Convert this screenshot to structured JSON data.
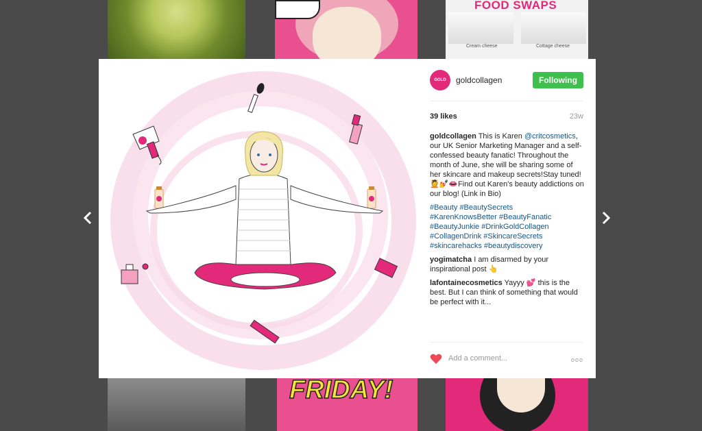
{
  "background": {
    "top_right_title": "FOOD SWAPS",
    "top_right_labels": [
      "Cream cheese",
      "Cottage cheese"
    ],
    "bottom_center_text": "FRIDAY!"
  },
  "modal": {
    "post": {
      "avatar_text": "GOLD COLLAGEN",
      "username": "goldcollagen",
      "follow_label": "Following",
      "likes": "39 likes",
      "age": "23w",
      "caption": {
        "author": "goldcollagen",
        "text_before": "This is Karen",
        "mention": "@critcosmetics",
        "text_after": ", our UK Senior Marketing Manager and a self-confessed beauty fanatic! Throughout the month of June, she will be sharing some of her skincare and makeup secrets!Stay tuned!💆💅👄Find out Karen's beauty addictions on our blog! (Link in Bio)"
      },
      "hashtags": [
        "#Beauty",
        "#BeautySecrets",
        "#KarenKnowsBetter",
        "#BeautyFanatic",
        "#BeautyJunkie",
        "#DrinkGoldCollagen",
        "#CollagenDrink",
        "#SkincareSecrets",
        "#skincarehacks",
        "#beautydiscovery"
      ],
      "comments": [
        {
          "user": "yogimatcha",
          "text": "I am disarmed by your inspirational post 👆"
        },
        {
          "user": "lafontainecosmetics",
          "text": "Yayyy 💕 this is the best. But I can think of something that would be perfect with it..."
        }
      ],
      "add_comment_placeholder": "Add a comment...",
      "more_glyph": "ooo"
    }
  },
  "icons": {
    "prev": "chevron-left-icon",
    "next": "chevron-right-icon",
    "heart": "heart-icon",
    "more": "more-options-icon"
  },
  "colors": {
    "accent_pink": "#e2297a",
    "follow_green": "#3fc04c",
    "link_blue": "#125688",
    "heart_red": "#ed4956"
  }
}
